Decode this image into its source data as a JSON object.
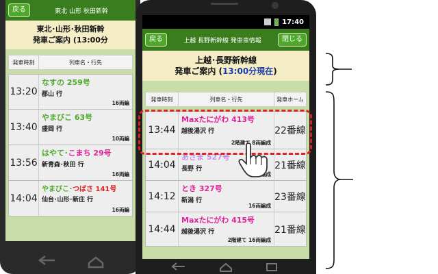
{
  "back": {
    "back_label": "戻る",
    "header_title": "東北 山形 秋田新幹",
    "banner_line1": "東北･山形･秋田新幹",
    "banner_line2": "発車ご案内 (13:00分",
    "col_time": "発車時刻",
    "col_train": "列車名・行先",
    "rows": [
      {
        "time": "13:20",
        "train": "なすの 259号",
        "dest": "郡山 行",
        "cars": "16両編"
      },
      {
        "time": "13:40",
        "train": "やまびこ 63号",
        "dest": "盛岡 行",
        "cars": "10両編"
      },
      {
        "time": "13:56",
        "train": "はやて･",
        "train2": "こまち 29号",
        "dest": "新青森･秋田 行",
        "cars": "16両編"
      },
      {
        "time": "14:04",
        "train": "やまびこ･",
        "train2": "つばさ 141号",
        "dest": "仙台･山形･新庄 行",
        "cars": "16両編"
      }
    ]
  },
  "front": {
    "status_time": "17:40",
    "back_label": "戻る",
    "header_title": "上越 長野新幹線 発車車情報",
    "close_label": "閉じる",
    "banner_line1": "上越･長野新幹線",
    "banner_line2_a": "発車ご案内 (",
    "banner_line2_b": "13:00分現在",
    "banner_line2_c": ")",
    "col_time": "発車時刻",
    "col_train": "列車名・行先",
    "col_platform": "発車ホーム",
    "rows": [
      {
        "time": "13:44",
        "train": "Maxたにがわ 413号",
        "dest": "越後湯沢 行",
        "cars": "2階建て 8両編成",
        "platform": "22番線",
        "color": "#e0209a"
      },
      {
        "time": "14:04",
        "train": "あさま 527号",
        "dest": "長野 行",
        "cars": "10両編成",
        "platform": "21番線",
        "color": "#c890e8"
      },
      {
        "time": "14:12",
        "train": "とき 327号",
        "dest": "新潟 行",
        "cars": "16両編成",
        "platform": "23番線",
        "color": "#e0209a"
      },
      {
        "time": "14:44",
        "train": "Maxたにがわ 415号",
        "dest": "越後湯沢 行",
        "cars": "2階建て 16両編成",
        "platform": "21番線",
        "color": "#e0209a"
      }
    ]
  },
  "colors": {
    "green_train": "#4fa82b",
    "orange_train": "#e06a10",
    "red_train": "#e02020",
    "pink_train": "#e0209a",
    "highlight": "#e02020"
  }
}
